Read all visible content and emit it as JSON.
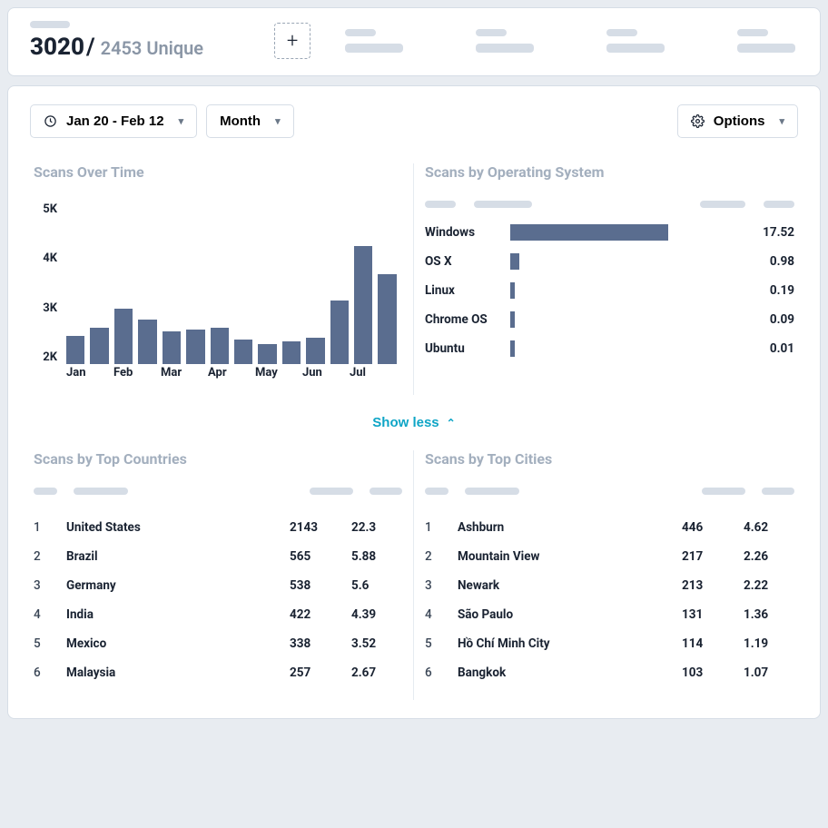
{
  "header": {
    "total": "3020",
    "slash": "/",
    "unique": "2453 Unique"
  },
  "toolbar": {
    "date_range": "Jan 20 - Feb 12",
    "granularity": "Month",
    "options_label": "Options"
  },
  "panels": {
    "scans_over_time_title": "Scans Over Time",
    "scans_by_os_title": "Scans by Operating System",
    "scans_by_countries_title": "Scans by Top Countries",
    "scans_by_cities_title": "Scans by Top Cities"
  },
  "show_less": "Show less",
  "chart_data": [
    {
      "type": "bar",
      "title": "Scans Over Time",
      "ylabel": "",
      "xlabel": "",
      "ylim": [
        1000,
        5000
      ],
      "y_ticks": [
        "5K",
        "4K",
        "3K",
        "2K"
      ],
      "x_ticks": [
        "Jan",
        "Feb",
        "Mar",
        "Apr",
        "May",
        "Jun",
        "Jul"
      ],
      "values": [
        1700,
        1900,
        2350,
        2100,
        1800,
        1850,
        1900,
        1600,
        1500,
        1550,
        1650,
        2550,
        3900,
        3200
      ]
    },
    {
      "type": "bar",
      "orientation": "horizontal",
      "title": "Scans by Operating System",
      "series": [
        {
          "name": "Windows",
          "value": 17.52
        },
        {
          "name": "OS X",
          "value": 0.98
        },
        {
          "name": "Linux",
          "value": 0.19
        },
        {
          "name": "Chrome OS",
          "value": 0.09
        },
        {
          "name": "Ubuntu",
          "value": 0.01
        }
      ],
      "xmax": 25
    },
    {
      "type": "table",
      "title": "Scans by Top Countries",
      "rows": [
        {
          "rank": 1,
          "name": "United States",
          "count": 2143,
          "pct": 22.3
        },
        {
          "rank": 2,
          "name": "Brazil",
          "count": 565,
          "pct": 5.88
        },
        {
          "rank": 3,
          "name": "Germany",
          "count": 538,
          "pct": 5.6
        },
        {
          "rank": 4,
          "name": "India",
          "count": 422,
          "pct": 4.39
        },
        {
          "rank": 5,
          "name": "Mexico",
          "count": 338,
          "pct": 3.52
        },
        {
          "rank": 6,
          "name": "Malaysia",
          "count": 257,
          "pct": 2.67
        }
      ]
    },
    {
      "type": "table",
      "title": "Scans by Top Cities",
      "rows": [
        {
          "rank": 1,
          "name": "Ashburn",
          "count": 446,
          "pct": 4.62
        },
        {
          "rank": 2,
          "name": "Mountain View",
          "count": 217,
          "pct": 2.26
        },
        {
          "rank": 3,
          "name": "Newark",
          "count": 213,
          "pct": 2.22
        },
        {
          "rank": 4,
          "name": "São Paulo",
          "count": 131,
          "pct": 1.36
        },
        {
          "rank": 5,
          "name": "Hồ Chí Minh City",
          "count": 114,
          "pct": 1.19
        },
        {
          "rank": 6,
          "name": "Bangkok",
          "count": 103,
          "pct": 1.07
        }
      ]
    }
  ]
}
